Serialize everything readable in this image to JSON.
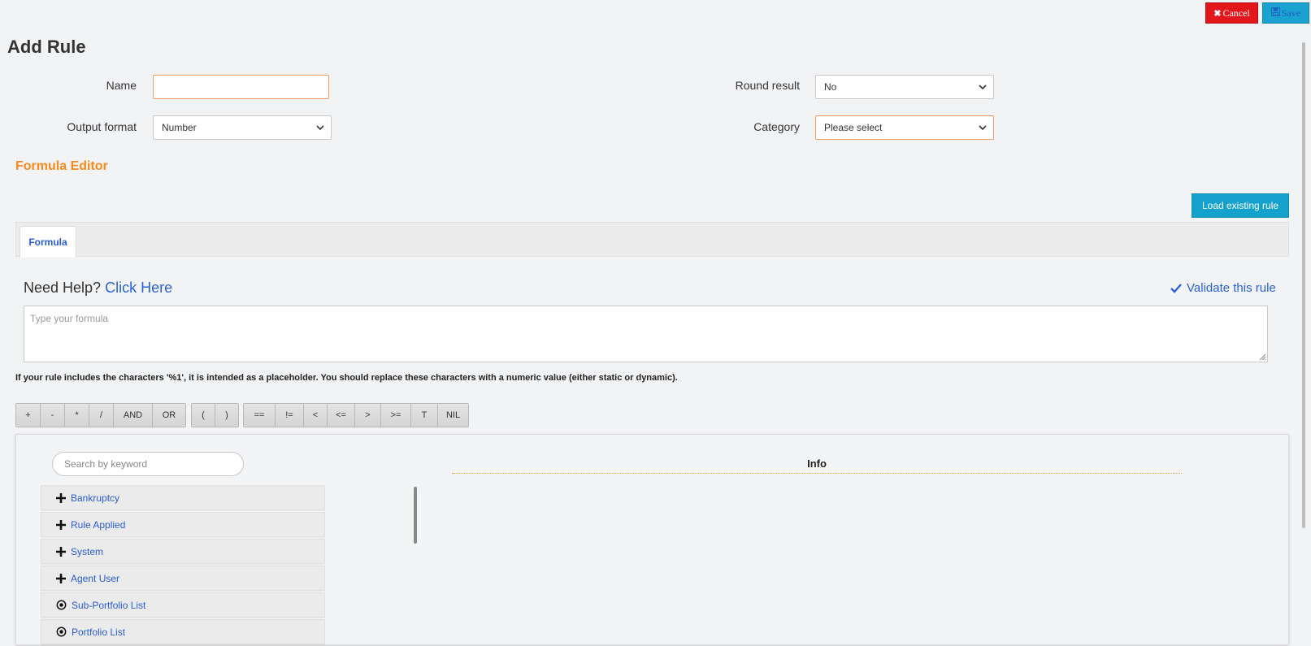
{
  "toolbar": {
    "cancel_label": "Cancel",
    "save_label": "Save"
  },
  "page": {
    "title": "Add Rule"
  },
  "form": {
    "name_label": "Name",
    "name_value": "",
    "output_format_label": "Output format",
    "output_format_value": "Number",
    "round_result_label": "Round result",
    "round_result_value": "No",
    "category_label": "Category",
    "category_value": "Please select"
  },
  "editor": {
    "section_title": "Formula Editor",
    "load_existing_label": "Load existing rule",
    "tabs": [
      {
        "label": "Formula"
      }
    ],
    "help_prefix": "Need Help?",
    "help_link": "Click Here",
    "validate_label": "Validate this rule",
    "formula_placeholder": "Type your formula",
    "note": "If your rule includes the characters '%1', it is intended as a placeholder. You should replace these characters with a numeric value (either static or dynamic)."
  },
  "operators": {
    "arith": [
      "+",
      "-",
      "*",
      "/",
      "AND",
      "OR"
    ],
    "parens": [
      "(",
      ")"
    ],
    "compare": [
      "==",
      "!=",
      "<",
      "<=",
      ">",
      ">=",
      "T",
      "NIL"
    ]
  },
  "browser": {
    "search_placeholder": "Search by keyword",
    "info_title": "Info",
    "items": [
      {
        "label": "Bankruptcy",
        "icon": "plus-icon"
      },
      {
        "label": "Rule Applied",
        "icon": "plus-icon"
      },
      {
        "label": "System",
        "icon": "plus-icon"
      },
      {
        "label": "Agent User",
        "icon": "plus-icon"
      },
      {
        "label": "Sub-Portfolio List",
        "icon": "radio-target-icon"
      },
      {
        "label": "Portfolio List",
        "icon": "radio-target-icon"
      }
    ]
  },
  "colors": {
    "accent_orange": "#f68a1e",
    "link_blue": "#2a5bd7",
    "cancel_red": "#e3171b",
    "save_cyan": "#1aa3d0"
  }
}
